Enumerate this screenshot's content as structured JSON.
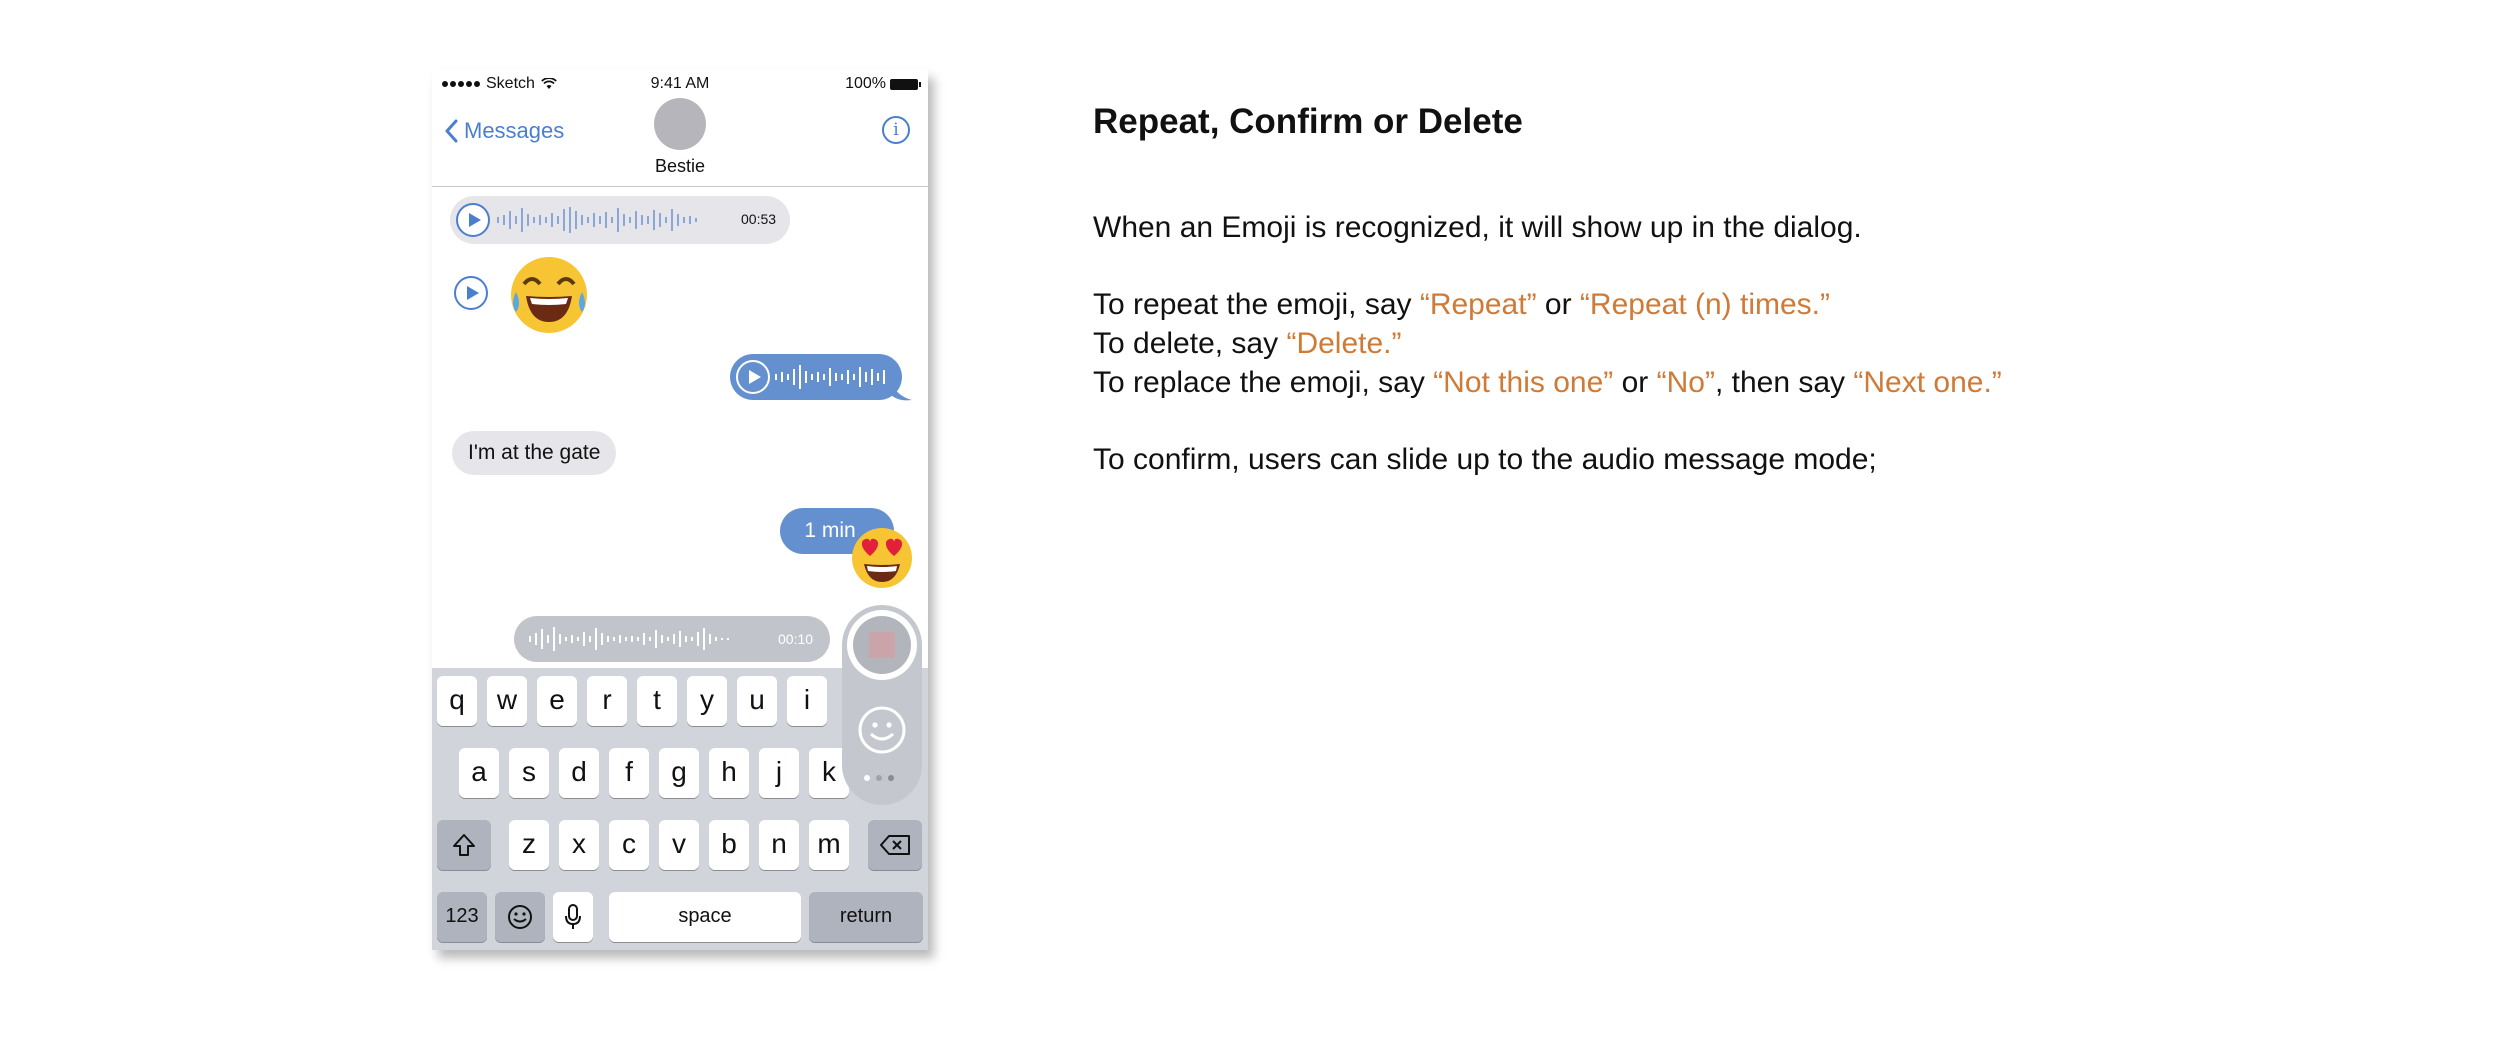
{
  "status_bar": {
    "carrier": "Sketch",
    "time": "9:41 AM",
    "battery": "100%"
  },
  "nav": {
    "back_label": "Messages",
    "contact_name": "Bestie",
    "info_symbol": "i"
  },
  "messages": {
    "audio1_duration": "00:53",
    "text_received": "I'm at the gate",
    "text_sent": "1 min"
  },
  "recording": {
    "duration": "00:10"
  },
  "keyboard": {
    "row1": [
      "q",
      "w",
      "e",
      "r",
      "t",
      "y",
      "u",
      "i"
    ],
    "row2": [
      "a",
      "s",
      "d",
      "f",
      "g",
      "h",
      "j",
      "k"
    ],
    "row3": [
      "z",
      "x",
      "c",
      "v",
      "b",
      "n",
      "m"
    ],
    "numbers_label": "123",
    "space_label": "space",
    "return_label": "return"
  },
  "colors": {
    "accent_blue": "#4a7fd0",
    "sent_bubble": "#6590cf",
    "highlight_orange": "#cf7a36"
  },
  "instructions": {
    "heading": "Repeat, Confirm or Delete",
    "intro": "When an Emoji is recognized, it will show up in the dialog.",
    "repeat_prefix": "To repeat the emoji, say ",
    "repeat_cmd1": "“Repeat”",
    "repeat_or": " or ",
    "repeat_cmd2": "“Repeat (n) times.”",
    "delete_prefix": "To delete, say ",
    "delete_cmd": "“Delete.”",
    "replace_prefix": "To replace the emoji, say ",
    "replace_cmd1": "“Not this one”",
    "replace_or": " or ",
    "replace_cmd2": "“No”",
    "replace_then": ", then say ",
    "replace_cmd3": "“Next one.”",
    "confirm": "To confirm, users can slide up to the audio message mode;"
  }
}
